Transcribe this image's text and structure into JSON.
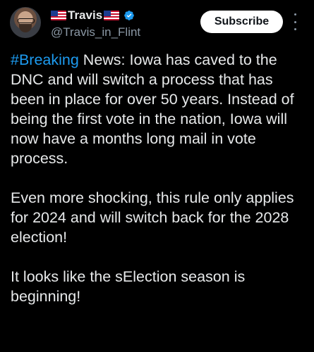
{
  "author": {
    "display_name": "Travis",
    "handle": "@Travis_in_Flint",
    "verified": true,
    "flag_emoji": "us-flag-icon"
  },
  "actions": {
    "subscribe_label": "Subscribe",
    "more_icon": "more-vertical-icon"
  },
  "tweet": {
    "hashtag": "#Breaking",
    "paragraph1_rest": " News: Iowa has caved to the DNC and will switch a process that has been in place for over 50 years.  Instead of being the first vote in the nation, Iowa will now have a months long mail in vote process.",
    "paragraph2": "Even more shocking, this rule only applies for 2024 and will switch back for the 2028 election!",
    "paragraph3": "It looks like the sElection season is beginning!"
  },
  "colors": {
    "background": "#000000",
    "text": "#e7e9ea",
    "secondary_text": "#8b98a5",
    "link": "#1d9bf0",
    "verified": "#1d9bf0",
    "button_bg": "#ffffff"
  }
}
